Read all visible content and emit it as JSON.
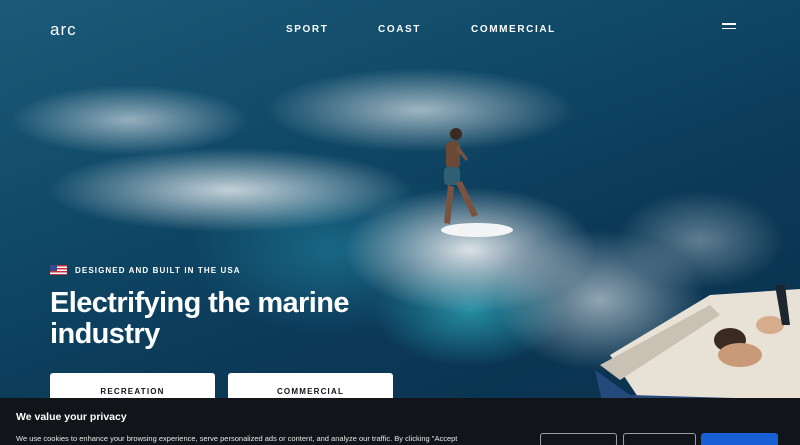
{
  "header": {
    "logo": "arc",
    "nav": [
      "SPORT",
      "COAST",
      "COMMERCIAL"
    ]
  },
  "hero": {
    "tagline": "DESIGNED AND BUILT IN THE USA",
    "headline": "Electrifying the marine industry",
    "buttons": [
      "RECREATION",
      "COMMERCIAL"
    ]
  },
  "cookie": {
    "title": "We value your privacy",
    "text": "We use cookies to enhance your browsing experience, serve personalized ads or content, and analyze our traffic. By clicking \"Accept"
  },
  "colors": {
    "banner_bg": "#111418",
    "accept_blue": "#1760d6",
    "water": "#0f4866"
  }
}
